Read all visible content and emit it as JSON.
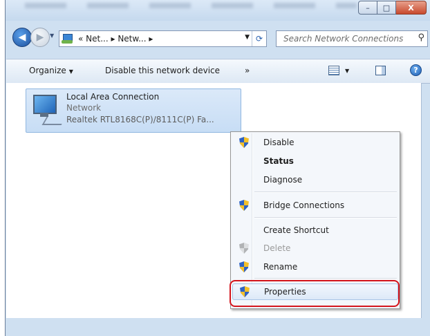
{
  "window": {
    "caption_buttons": [
      {
        "name": "minimize",
        "glyph": "–"
      },
      {
        "name": "maximize",
        "glyph": "□"
      },
      {
        "name": "close",
        "glyph": "X"
      }
    ]
  },
  "address": {
    "crumbs": "«  Net...  ▸ Netw...  ▸",
    "search_placeholder": "Search Network Connections"
  },
  "toolbar": {
    "organize": "Organize",
    "disable_device": "Disable this network device",
    "more": "»"
  },
  "connection": {
    "title": "Local Area Connection",
    "status": "Network",
    "device": "Realtek RTL8168C(P)/8111C(P) Fa..."
  },
  "context_menu": {
    "items": [
      {
        "label": "Disable",
        "icon": "uac-shield-icon",
        "bold": false,
        "disabled": false
      },
      {
        "label": "Status",
        "icon": null,
        "bold": true,
        "disabled": false
      },
      {
        "label": "Diagnose",
        "icon": null,
        "bold": false,
        "disabled": false
      },
      {
        "label": "Bridge Connections",
        "icon": "uac-shield-icon",
        "bold": false,
        "disabled": false
      },
      {
        "label": "Create Shortcut",
        "icon": null,
        "bold": false,
        "disabled": false
      },
      {
        "label": "Delete",
        "icon": "uac-shield-icon",
        "bold": false,
        "disabled": true
      },
      {
        "label": "Rename",
        "icon": "uac-shield-icon",
        "bold": false,
        "disabled": false
      },
      {
        "label": "Properties",
        "icon": "uac-shield-icon",
        "bold": false,
        "disabled": false,
        "highlighted": true
      }
    ]
  },
  "colors": {
    "highlight_outline": "#d4141b",
    "selection_fill": "#cce0f7"
  }
}
